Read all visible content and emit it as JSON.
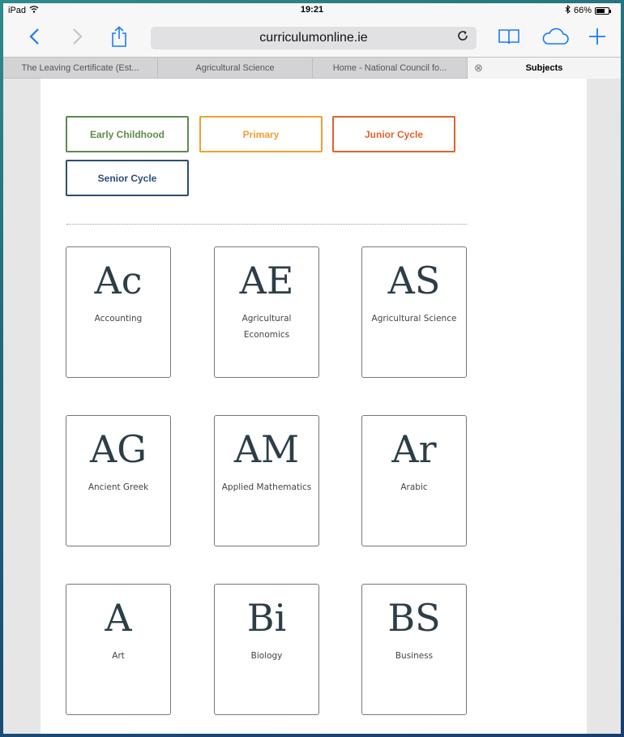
{
  "status": {
    "device": "iPad",
    "time": "19:21",
    "battery": "66%"
  },
  "toolbar": {
    "url": "curriculumonline.ie",
    "reload": "C"
  },
  "tabs": [
    {
      "label": "The Leaving Certificate (Est...",
      "active": false
    },
    {
      "label": "Agricultural Science",
      "active": false
    },
    {
      "label": "Home - National Council fo...",
      "active": false
    },
    {
      "label": "Subjects",
      "active": true
    }
  ],
  "filters": [
    {
      "label": "Early Childhood",
      "color": "#5e8a4e"
    },
    {
      "label": "Primary",
      "color": "#f0a030"
    },
    {
      "label": "Junior Cycle",
      "color": "#e0622c"
    },
    {
      "label": "Senior Cycle",
      "color": "#2a4e7a"
    }
  ],
  "subjects": [
    {
      "abbr": "Ac",
      "name": "Accounting"
    },
    {
      "abbr": "AE",
      "name": "Agricultural Economics"
    },
    {
      "abbr": "AS",
      "name": "Agricultural Science"
    },
    {
      "abbr": "AG",
      "name": "Ancient Greek"
    },
    {
      "abbr": "AM",
      "name": "Applied Mathematics"
    },
    {
      "abbr": "Ar",
      "name": "Arabic"
    },
    {
      "abbr": "A",
      "name": "Art"
    },
    {
      "abbr": "Bi",
      "name": "Biology"
    },
    {
      "abbr": "BS",
      "name": "Business"
    }
  ]
}
